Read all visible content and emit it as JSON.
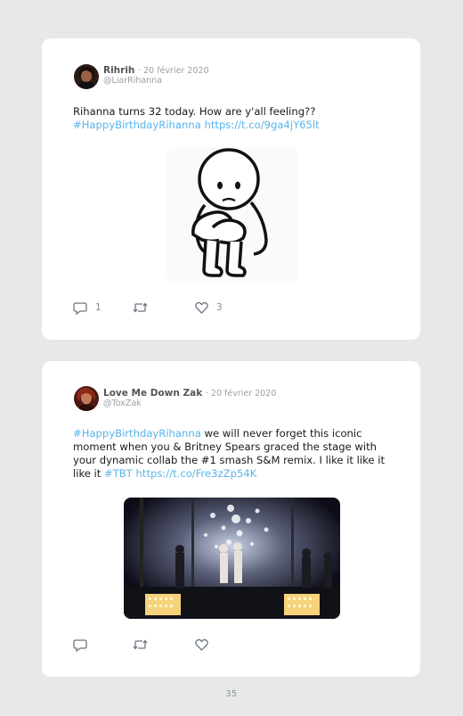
{
  "tweets": [
    {
      "author": "Rihrih",
      "date": "20 février 2020",
      "handle": "@LiarRihanna",
      "text_plain": "Rihanna turns 32 today. How are y'all feeling??",
      "hashtag": "#HappyBirthdayRihanna",
      "link": "https://t.co/9ga4jY65lt",
      "replies": "1",
      "likes": "3",
      "icons": [
        "reply-icon",
        "retweet-icon",
        "heart-icon"
      ],
      "media": "sad-stick-figure-hugging-knees"
    },
    {
      "author": "Love Me Down Zak",
      "date": "20 février 2020",
      "handle": "@ToxZak",
      "hashtag": "#HappyBirthdayRihanna",
      "text_plain": " we will never forget this iconic moment when you & Britney Spears graced the stage with your dynamic collab the #1 smash S&M remix. I like it like it like it ",
      "hashtag2": "#TBT",
      "link": "https://t.co/Fre3zZp54K",
      "icons": [
        "reply-icon",
        "retweet-icon",
        "heart-icon"
      ],
      "media": "concert-stage-performance"
    }
  ],
  "page_number": "35",
  "colors": {
    "background": "#e8e8e6",
    "card": "#ffffff",
    "link": "#5ab4e8",
    "muted": "#9aa0a6"
  }
}
